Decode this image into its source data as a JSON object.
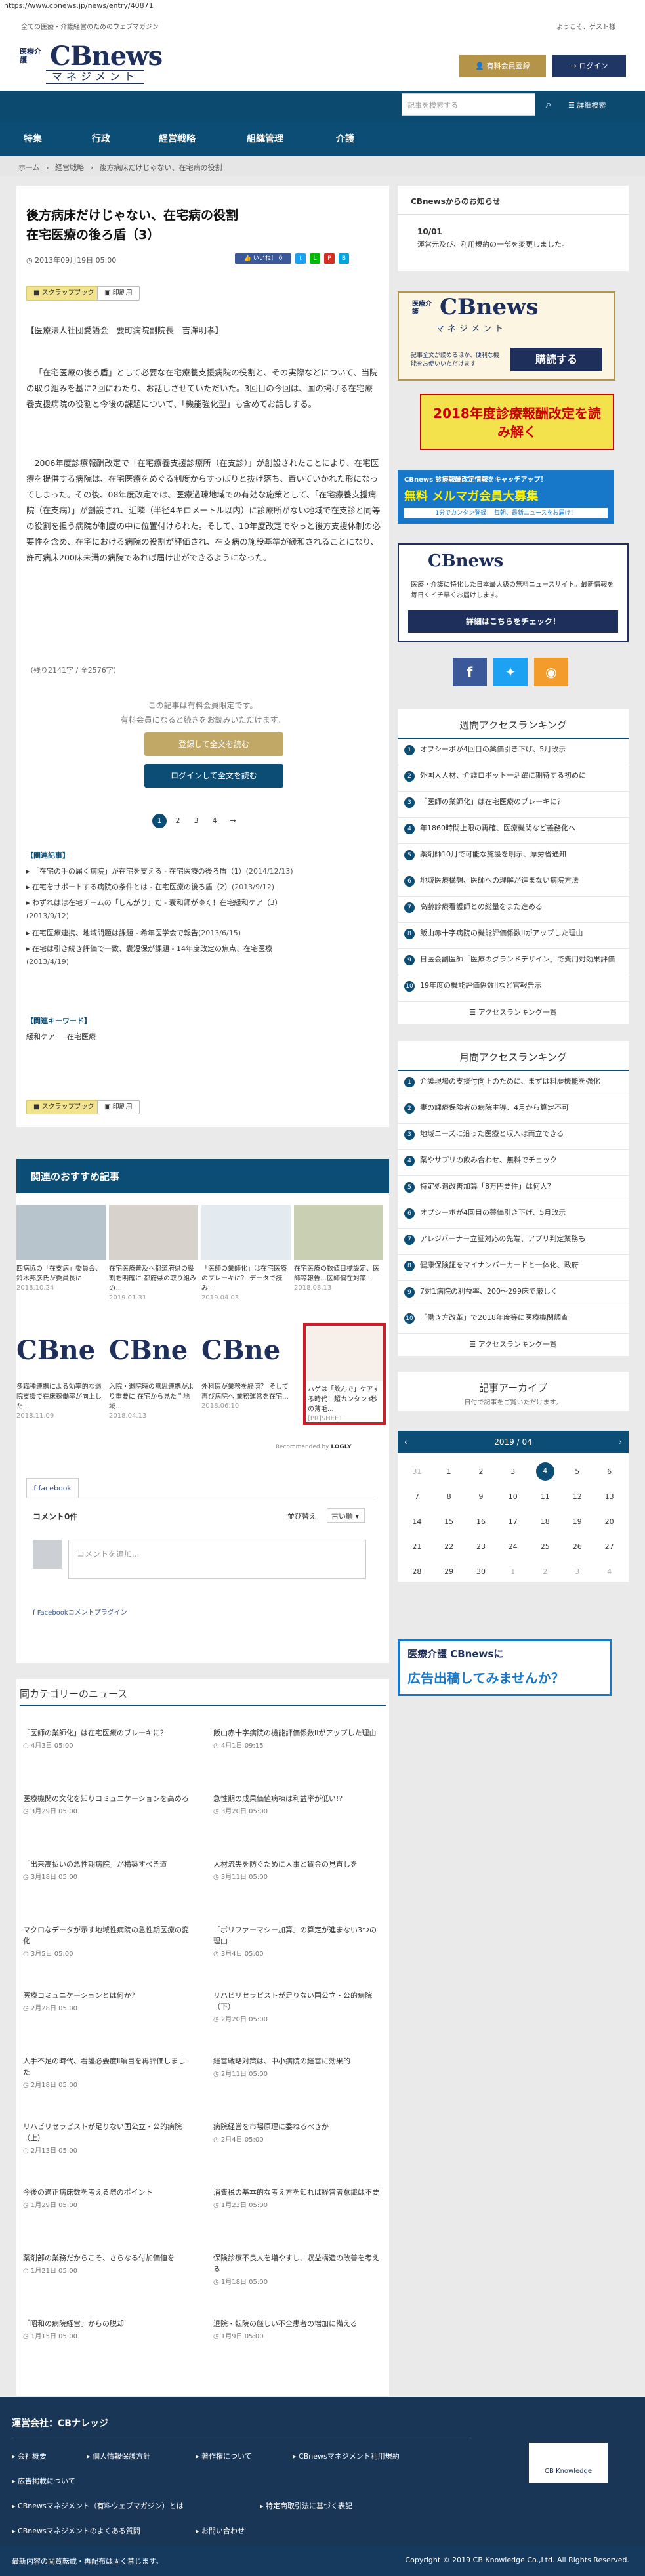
{
  "browser": {
    "url": "https://www.cbnews.jp/news/entry/40871"
  },
  "header": {
    "tagline": "全ての医療・介護経営のためのウェブマガジン",
    "welcome": "ようこそ、ゲスト様",
    "logo_small": "医療介護",
    "logo_main": "CBnews",
    "logo_sub": "マネジメント",
    "member_button": "有料会員登録",
    "login_button": "ログイン",
    "search_placeholder": "記事を検索する",
    "advanced_search": "詳細検索"
  },
  "nav": [
    "特集",
    "行政",
    "経営戦略",
    "組織管理",
    "介護"
  ],
  "breadcrumb": {
    "home": "ホーム",
    "sep": "›",
    "section": "経営戦略",
    "current": "後方病床だけじゃない、在宅病の役割"
  },
  "article": {
    "title": "後方病床だけじゃない、在宅病の役割\n在宅医療の後ろ盾（3）",
    "date": "2013年09月19日 05:00",
    "scrapbook": "スクラップブック",
    "print": "印刷用",
    "author": "【医療法人社団愛語会　要町病院副院長　吉澤明孝】",
    "p1": "「在宅医療の後ろ盾」として必要な在宅療養支援病院の役割と、その実際などについて、当院の取り組みを基に2回にわたり、お話しさせていただいた。3回目の今回は、国の掲げる在宅療養支援病院の役割と今後の課題について、「機能強化型」も含めてお話しする。",
    "p2": "2006年度診療報酬改定で「在宅療養支援診療所（在支診）」が創設されたことにより、在宅医療を提供する病院は、在宅医療をめぐる制度からすっぽりと抜け落ち、置いていかれた形になってしまった。その後、08年度改定では、医療過疎地域での有効な施策として、「在宅療養支援病院（在支病）」が創設され、近隣（半径4キロメートル以内）に診療所がない地域で在支診と同等の役割を担う病院が制度の中に位置付けられた。そして、10年度改定でやっと後方支援体制の必要性を含め、在宅における病院の役割が評価され、在支病の施設基準が緩和されることになり、許可病床200床未満の病院であれば届け出ができるようになった。",
    "remaining": "（残り2141字 / 全2576字）",
    "members_only": "この記事は有料会員限定です。",
    "members_only2": "有料会員になると続きをお読みいただけます。",
    "register_button": "登録して全文を読む",
    "login_button": "ログインして全文を読む",
    "pages": [
      "1",
      "2",
      "3",
      "4",
      "→"
    ],
    "related_head": "【関連記事】",
    "related": [
      {
        "t": "「在宅の手の届く病院」が在宅を支える - 在宅医療の後ろ盾（1）",
        "d": "(2014/12/13)"
      },
      {
        "t": "在宅をサポートする病院の条件とは - 在宅医療の後ろ盾（2）",
        "d": "(2013/9/12)"
      },
      {
        "t": "わずれはは在宅チームの「しんがり」だ - 嚢和師がゆく！在宅緩和ケア（3）",
        "d": "(2013/9/12)"
      },
      {
        "t": "在宅医療連携、地域問題は課題 - 希年医学会で報告",
        "d": "(2013/6/15)"
      },
      {
        "t": "在宅は引き続き評価で一致、嚢短保が課題 - 14年度改定の焦点、在宅医療",
        "d": "(2013/4/19)"
      }
    ],
    "keyword_head": "【関連キーワード】",
    "keywords": [
      "緩和ケア",
      "在宅医療"
    ]
  },
  "recommended": {
    "head": "関連のおすすめ記事",
    "cards": [
      {
        "t": "四病協の「在支病」委員会、鈴木邦彦氏が委員長に",
        "d": "2018.10.24"
      },
      {
        "t": "在宅医療普及へ都道府県の役割を明確に 都府県の取り組みの...",
        "d": "2019.01.31"
      },
      {
        "t": "「医師の業師化」は在宅医療のブレーキに？ データで読み...",
        "d": "2019.04.03"
      },
      {
        "t": "在宅医療の数値目標設定、医師等報告…医師偏在対策...",
        "d": "2018.08.13"
      },
      {
        "t": "多職種連携による効率的な退院支援で在床稼働率が向上した...",
        "d": "2018.11.09"
      },
      {
        "t": "入院・退院時の意思連携がより重要に 在宅から見た＂地域...",
        "d": "2018.04.13"
      },
      {
        "t": "外科医が業務を経済？ そして再び病院へ 業務運営を在宅...",
        "d": "2018.06.10"
      },
      {
        "t": "ハゲは「飲んで」ケアする時代！超カンタン3秒の薄毛...",
        "d": "[PR]SHEET"
      }
    ],
    "powered": "Recommended by",
    "powered_brand": "LOGLY"
  },
  "facebook": {
    "tab": "facebook",
    "count": "コメント0件",
    "sort": "並び替え",
    "sort_value": "古い順",
    "placeholder": "コメントを追加...",
    "plugin": "Facebookコメントプラグイン"
  },
  "category_news": {
    "head": "同カテゴリーのニュース",
    "items": [
      {
        "t": "「医師の業師化」は在宅医療のブレーキに？",
        "d": "4月3日 05:00"
      },
      {
        "t": "飯山赤十字病院の機能評価係数IIがアップした理由",
        "d": "4月1日 09:15"
      },
      {
        "t": "医療機関の文化を知りコミュニケーションを高める",
        "d": "3月29日 05:00"
      },
      {
        "t": "急性期の成果価値病棟は利益率が低い!?",
        "d": "3月20日 05:00"
      },
      {
        "t": "「出来高払いの急性期病院」が構築すべき道",
        "d": "3月18日 05:00"
      },
      {
        "t": "人材流失を防ぐために人事と賃金の見直しを",
        "d": "3月11日 05:00"
      },
      {
        "t": "マクロなデータが示す地域性病院の急性期医療の変化",
        "d": "3月5日 05:00"
      },
      {
        "t": "「ボリファーマシー加算」の算定が進まない3つの理由",
        "d": "3月4日 05:00"
      },
      {
        "t": "医療コミュニケーションとは何か？",
        "d": "2月28日 05:00"
      },
      {
        "t": "リハビリセラピストが足りない国公立・公的病院（下）",
        "d": "2月20日 05:00"
      },
      {
        "t": "人手不足の時代、看護必要度Ⅱ項目を再評価しました",
        "d": "2月18日 05:00"
      },
      {
        "t": "経営戦略対策は、中小病院の経営に効果的",
        "d": "2月11日 05:00"
      },
      {
        "t": "リハビリセラピストが足りない国公立・公的病院（上）",
        "d": "2月13日 05:00"
      },
      {
        "t": "病院経営を市場原理に委ねるべきか",
        "d": "2月4日 05:00"
      },
      {
        "t": "今後の適正病床数を考える際のポイント",
        "d": "1月29日 05:00"
      },
      {
        "t": "消費税の基本的な考え方を知れば経営者意識は不要",
        "d": "1月23日 05:00"
      },
      {
        "t": "薬剤部の業務だからこそ、さらなる付加価値を",
        "d": "1月21日 05:00"
      },
      {
        "t": "保険診療不良人を増やすし、収益構造の改善を考える",
        "d": "1月18日 05:00"
      },
      {
        "t": "「昭和の病院経営」からの脱却",
        "d": "1月15日 05:00"
      },
      {
        "t": "退院・転院の厳しい不全患者の増加に備える",
        "d": "1月9日 05:00"
      }
    ]
  },
  "sidebar": {
    "notice_head": "CBnewsからのお知らせ",
    "notice_date": "10/01",
    "notice_text": "運営元及び、利用規約の一部を変更しました。",
    "banner1_small": "医療介護",
    "banner1_main": "CBnews",
    "banner1_sub": "マネジメント",
    "banner1_text": "記事全文が読めるほか、便利な機能をお使いいただけます",
    "banner1_btn": "購読する",
    "banner2": "2018年度診療報酬改定を読み解く",
    "banner3_head": "CBnews 診療報酬改定情報をキャッチアップ！",
    "banner3_main": "無料 メルマガ会員大募集",
    "banner3_sub": "1分でカンタン登録！ 毎朝、最新ニュースをお届け！",
    "info_brand": "CBnews",
    "info_text": "医療・介護に特化した日本最大級の無料ニュースサイト。最新情報を毎日くイチ早くお届けします。",
    "info_btn": "詳細はこちらをチェック！",
    "weekly_head": "週間アクセスランキング",
    "weekly": [
      "オプシーボが4回目の薬価引き下げ、5月改示",
      "外国人人材、介護ロボット一活躍に期待する初めに",
      "「医師の業師化」は在宅医療のブレーキに？",
      "年1860時間上限の再確、医療機関など義務化へ",
      "薬剤師10月で可能な施設を明示、厚労省通知",
      "地域医療構想、医師への理解が進まない病院方法",
      "高齢診療看護師との総量をまた進める",
      "飯山赤十字病院の機能評価係数IIがアップした理由",
      "日医会副医師「医療のグランドデザイン」で費用対効果評価",
      "19年度の機能評価係数IIなど官報告示"
    ],
    "weekly_more": "アクセスランキング一覧",
    "monthly_head": "月間アクセスランキング",
    "monthly": [
      "介護現場の支援付向上のために、まずは料歴機能を強化",
      "妻の課療保険者の病院主導、4月から算定不可",
      "地域ニーズに沿った医療と収入は両立できる",
      "薬やサプリの飲み合わせ、無料でチェック",
      "特定処遇改善加算「8万円要件」は何人？",
      "オプシーボが4回目の薬価引き下げ、5月改示",
      "アレジバーナー立証対応の先端、アプリ判定業務も",
      "健康保険証をマイナンバーカードと一体化、政府",
      "7対1病院の利益率、200～299床で厳しく",
      "「働き方改革」で2018年度等に医療機関調査"
    ],
    "monthly_more": "アクセスランキング一覧",
    "archive_head": "記事アーカイブ",
    "archive_sub": "日付で記事をご覧いただけます。",
    "archive_month": "2019 / 04",
    "calendar": [
      [
        "31",
        "1",
        "2",
        "3",
        "4",
        "5",
        "6"
      ],
      [
        "7",
        "8",
        "9",
        "10",
        "11",
        "12",
        "13"
      ],
      [
        "14",
        "15",
        "16",
        "17",
        "18",
        "19",
        "20"
      ],
      [
        "21",
        "22",
        "23",
        "24",
        "25",
        "26",
        "27"
      ],
      [
        "28",
        "29",
        "30",
        "1",
        "2",
        "3",
        "4"
      ]
    ],
    "ad_head": "医療介護 CBnewsに",
    "ad_text": "広告出稿してみませんか？"
  },
  "footer": {
    "head": "運営会社：CBナレッジ",
    "links": [
      "会社概要",
      "個人情報保護方針",
      "著作権について",
      "CBnewsマネジメント利用規約",
      "広告掲載について",
      "CBnewsマネジメント（有料ウェブマガジン）とは",
      "特定商取引法に基づく表記",
      "CBnewsマネジメントのよくある質問",
      "お問い合わせ"
    ],
    "badge": "CB Knowledge",
    "notice": "最新内容の閲覧転載・再配布は固く禁じます。",
    "copyright": "Copyright © 2019 CB Knowledge Co.,Ltd. All Rights Reserved."
  },
  "colors": {
    "navy": "#0c4d75",
    "gold": "#b39448",
    "pale_yellow": "#f2e38f"
  }
}
